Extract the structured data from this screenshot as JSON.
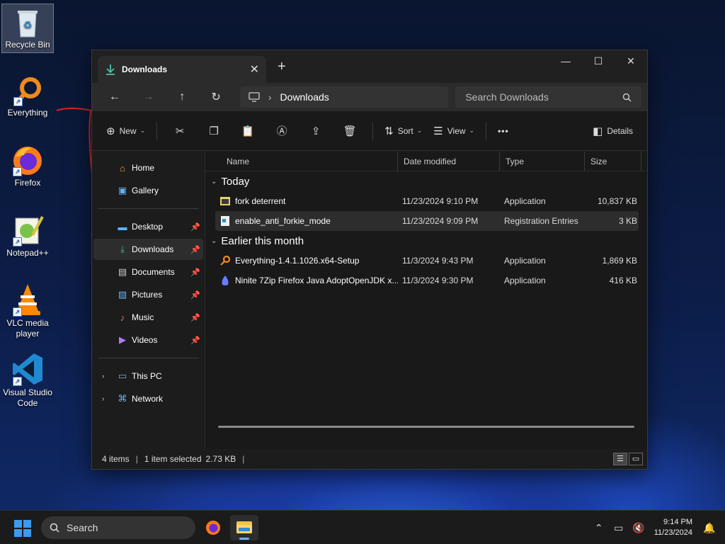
{
  "desktop": {
    "icons": [
      {
        "label": "Recycle Bin"
      },
      {
        "label": "Everything"
      },
      {
        "label": "Firefox"
      },
      {
        "label": "Notepad++"
      },
      {
        "label": "VLC media player"
      },
      {
        "label": "Visual Studio Code"
      }
    ]
  },
  "window": {
    "tab_title": "Downloads",
    "close_tab": "✕",
    "new_tab": "+",
    "controls": {
      "minimize": "—",
      "maximize": "☐",
      "close": "✕"
    },
    "address": {
      "root_icon": "monitor-icon",
      "separator": "›",
      "location": "Downloads"
    },
    "search_placeholder": "Search Downloads",
    "commands": {
      "new": "New",
      "sort": "Sort",
      "view": "View",
      "more": "•••",
      "details": "Details"
    },
    "nav": {
      "quick": [
        {
          "label": "Home",
          "icon": "home-icon"
        },
        {
          "label": "Gallery",
          "icon": "gallery-icon"
        }
      ],
      "pinned": [
        {
          "label": "Desktop",
          "icon": "desktop-icon"
        },
        {
          "label": "Downloads",
          "icon": "download-icon",
          "selected": true
        },
        {
          "label": "Documents",
          "icon": "document-icon"
        },
        {
          "label": "Pictures",
          "icon": "pictures-icon"
        },
        {
          "label": "Music",
          "icon": "music-icon"
        },
        {
          "label": "Videos",
          "icon": "videos-icon"
        }
      ],
      "devices": [
        {
          "label": "This PC",
          "icon": "pc-icon"
        },
        {
          "label": "Network",
          "icon": "network-icon"
        }
      ]
    },
    "columns": {
      "name": "Name",
      "date": "Date modified",
      "type": "Type",
      "size": "Size"
    },
    "groups": [
      {
        "label": "Today",
        "files": [
          {
            "name": "fork deterrent",
            "date": "11/23/2024 9:10 PM",
            "type": "Application",
            "size": "10,837 KB",
            "icon": "application-icon"
          },
          {
            "name": "enable_anti_forkie_mode",
            "date": "11/23/2024 9:09 PM",
            "type": "Registration Entries",
            "size": "3 KB",
            "icon": "registry-icon",
            "selected": true
          }
        ]
      },
      {
        "label": "Earlier this month",
        "files": [
          {
            "name": "Everything-1.4.1.1026.x64-Setup",
            "date": "11/3/2024 9:43 PM",
            "type": "Application",
            "size": "1,869 KB",
            "icon": "everything-icon"
          },
          {
            "name": "Ninite 7Zip Firefox Java AdoptOpenJDK x...",
            "date": "11/3/2024 9:30 PM",
            "type": "Application",
            "size": "416 KB",
            "icon": "ninite-icon"
          }
        ]
      }
    ],
    "status": {
      "items": "4 items",
      "selected": "1 item selected",
      "size": "2.73 KB"
    }
  },
  "taskbar": {
    "search_label": "Search",
    "time": "9:14 PM",
    "date": "11/23/2024"
  },
  "colors": {
    "accent": "#3a9bf0",
    "window_bg": "#1c1c1c",
    "selected_bg": "#2d2d2d"
  }
}
